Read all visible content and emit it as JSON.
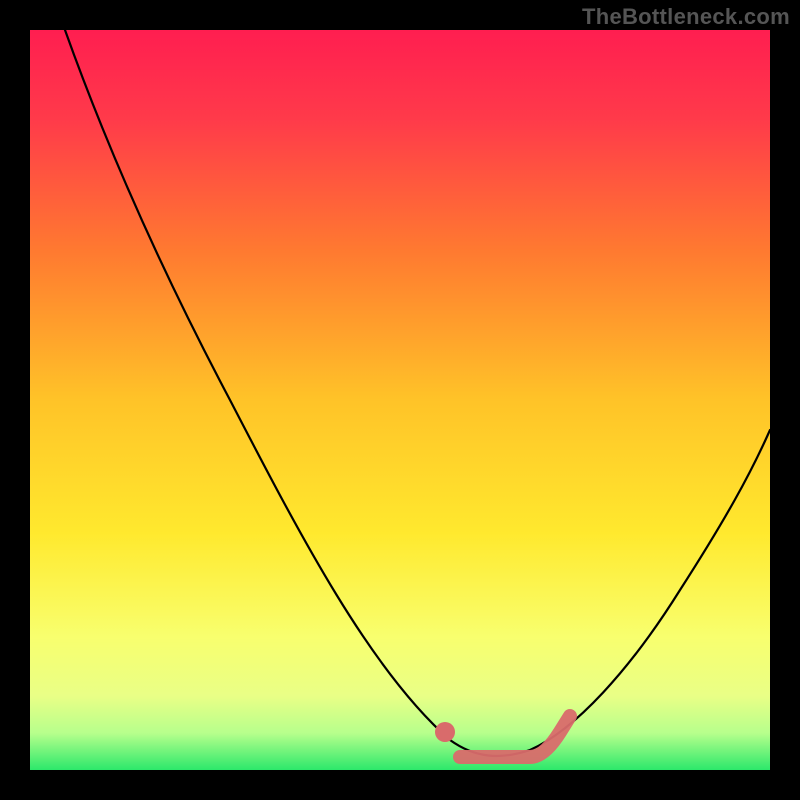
{
  "watermark": "TheBottleneck.com",
  "colors": {
    "gradient_top": "#FF1E50",
    "gradient_mid1": "#FF8A2A",
    "gradient_mid2": "#FFE92E",
    "gradient_mid3": "#F6FF77",
    "gradient_bottom": "#2CE86B",
    "curve": "#000000",
    "overlay": "#D96B6B",
    "page_bg": "#000000"
  },
  "chart_data": {
    "type": "line",
    "title": "",
    "xlabel": "",
    "ylabel": "",
    "xlim": [
      0,
      100
    ],
    "ylim": [
      0,
      100
    ],
    "series": [
      {
        "name": "bottleneck-curve",
        "x": [
          5,
          15,
          25,
          35,
          45,
          55,
          60,
          65,
          70,
          80,
          90,
          100
        ],
        "y": [
          100,
          82,
          64,
          46,
          28,
          10,
          3,
          2,
          4,
          14,
          30,
          48
        ]
      },
      {
        "name": "optimal-range-overlay",
        "x": [
          56,
          60,
          65,
          70,
          72
        ],
        "y": [
          6,
          3,
          2,
          4,
          7
        ]
      }
    ],
    "optimal_point": {
      "x": 56,
      "y": 6
    }
  }
}
